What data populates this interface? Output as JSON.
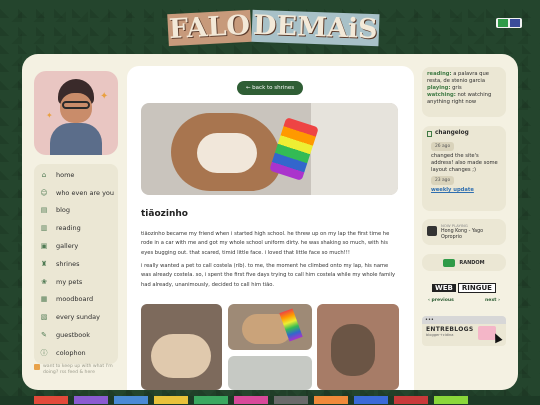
{
  "header": {
    "title_parts": [
      "FALO",
      "DEMAiS"
    ],
    "lang_flags": [
      "pt",
      "en"
    ]
  },
  "nav": {
    "items": [
      {
        "label": "home",
        "icon": "home-icon"
      },
      {
        "label": "who even are you",
        "icon": "person-icon"
      },
      {
        "label": "blog",
        "icon": "blog-icon"
      },
      {
        "label": "reading",
        "icon": "book-icon"
      },
      {
        "label": "gallery",
        "icon": "gallery-icon"
      },
      {
        "label": "shrines",
        "icon": "shrine-icon"
      },
      {
        "label": "my pets",
        "icon": "paw-icon"
      },
      {
        "label": "moodboard",
        "icon": "board-icon"
      },
      {
        "label": "every sunday",
        "icon": "calendar-icon"
      },
      {
        "label": "guestbook",
        "icon": "guestbook-icon"
      },
      {
        "label": "colophon",
        "icon": "info-icon"
      }
    ]
  },
  "footer_note": "want to keep up with what I'm doing? rss feed & here",
  "content": {
    "back_button": "← back to shrines",
    "post_title": "tiãozinho",
    "paragraphs": [
      "tiãozinho became my friend when i started high school. he threw up on my lap the first time he rode in a car with me and got my whole school uniform dirty. he was shaking so much, with his eyes bugging out. that scared, timid little face. i loved that little face so much!!!",
      "i really wanted a pet to call costela (rib). to me, the moment he climbed onto my lap, his name was already costela. so, i spent the first five days trying to call him costela while my whole family had already, unanimously, decided to call him tião."
    ]
  },
  "status": {
    "reading_label": "reading:",
    "reading_value": "a palavra que resta, de stenio garcia",
    "playing_label": "playing:",
    "playing_value": "gris",
    "watching_label": "watching:",
    "watching_value": "not watching anything right now"
  },
  "changelog": {
    "title": "changelog",
    "entries": [
      {
        "date": "26 ago",
        "text": "changed the site's address! also made some layout changes ;)"
      },
      {
        "date": "23 ago",
        "text": "weekly update"
      }
    ]
  },
  "now_playing": {
    "label": "NOW PLAYING",
    "track": "Hong Kong - Yago Oproprio"
  },
  "random_button": "RANDOM",
  "webring": {
    "logo_left": "WEB",
    "logo_right": "RINGUE",
    "previous": "‹ previous",
    "next": "next ›"
  },
  "entreblogs": {
    "dots": "•••",
    "name": "ENTREBLOGS",
    "subtitle": "blogger+cidina"
  },
  "colors": {
    "background": "#24452d",
    "card": "#f4f1e2",
    "accent": "#2f5e35",
    "label_green": "#3f7a44"
  }
}
